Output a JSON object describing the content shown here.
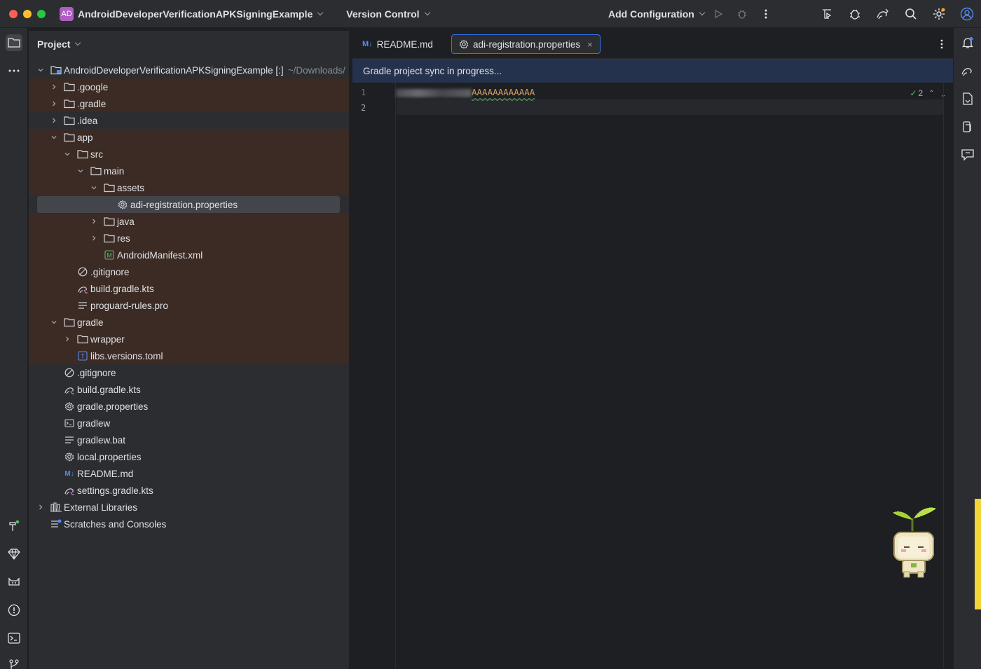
{
  "titlebar": {
    "project_badge": "AD",
    "project_name": "AndroidDeveloperVerificationAPKSigningExample",
    "vcs_label": "Version Control",
    "add_configuration": "Add Configuration"
  },
  "project_panel": {
    "title": "Project",
    "tree": [
      {
        "label": "AndroidDeveloperVerificationAPKSigningExample [:]",
        "hint": "~/Downloads/",
        "depth": 0,
        "arrow": "down",
        "icon": "module-folder-icon"
      },
      {
        "label": ".google",
        "depth": 1,
        "arrow": "right",
        "icon": "folder-icon"
      },
      {
        "label": ".gradle",
        "depth": 1,
        "arrow": "right",
        "icon": "folder-icon"
      },
      {
        "label": ".idea",
        "depth": 1,
        "arrow": "right",
        "icon": "folder-icon"
      },
      {
        "label": "app",
        "depth": 1,
        "arrow": "down",
        "icon": "folder-icon"
      },
      {
        "label": "src",
        "depth": 2,
        "arrow": "down",
        "icon": "folder-icon"
      },
      {
        "label": "main",
        "depth": 3,
        "arrow": "down",
        "icon": "folder-icon"
      },
      {
        "label": "assets",
        "depth": 4,
        "arrow": "down",
        "icon": "folder-icon"
      },
      {
        "label": "adi-registration.properties",
        "depth": 5,
        "arrow": "none",
        "icon": "properties-icon"
      },
      {
        "label": "java",
        "depth": 4,
        "arrow": "right",
        "icon": "folder-icon"
      },
      {
        "label": "res",
        "depth": 4,
        "arrow": "right",
        "icon": "folder-icon"
      },
      {
        "label": "AndroidManifest.xml",
        "depth": 4,
        "arrow": "none",
        "icon": "manifest-icon"
      },
      {
        "label": ".gitignore",
        "depth": 2,
        "arrow": "none",
        "icon": "gitignore-icon"
      },
      {
        "label": "build.gradle.kts",
        "depth": 2,
        "arrow": "none",
        "icon": "gradle-icon"
      },
      {
        "label": "proguard-rules.pro",
        "depth": 2,
        "arrow": "none",
        "icon": "text-file-icon"
      },
      {
        "label": "gradle",
        "depth": 1,
        "arrow": "down",
        "icon": "folder-icon"
      },
      {
        "label": "wrapper",
        "depth": 2,
        "arrow": "right",
        "icon": "folder-icon"
      },
      {
        "label": "libs.versions.toml",
        "depth": 2,
        "arrow": "none",
        "icon": "toml-icon"
      },
      {
        "label": ".gitignore",
        "depth": 1,
        "arrow": "none",
        "icon": "gitignore-icon"
      },
      {
        "label": "build.gradle.kts",
        "depth": 1,
        "arrow": "none",
        "icon": "gradle-icon"
      },
      {
        "label": "gradle.properties",
        "depth": 1,
        "arrow": "none",
        "icon": "properties-icon"
      },
      {
        "label": "gradlew",
        "depth": 1,
        "arrow": "none",
        "icon": "shell-icon"
      },
      {
        "label": "gradlew.bat",
        "depth": 1,
        "arrow": "none",
        "icon": "text-file-icon"
      },
      {
        "label": "local.properties",
        "depth": 1,
        "arrow": "none",
        "icon": "properties-icon"
      },
      {
        "label": "README.md",
        "depth": 1,
        "arrow": "none",
        "icon": "markdown-icon"
      },
      {
        "label": "settings.gradle.kts",
        "depth": 1,
        "arrow": "none",
        "icon": "gradle-icon"
      },
      {
        "label": "External Libraries",
        "depth": 0,
        "arrow": "right",
        "icon": "libraries-icon"
      },
      {
        "label": "Scratches and Consoles",
        "depth": 0,
        "arrow": "none",
        "icon": "scratches-icon"
      }
    ],
    "selected_index": 8
  },
  "editor": {
    "tabs": [
      {
        "label": "README.md",
        "icon": "markdown-icon",
        "active": false
      },
      {
        "label": "adi-registration.properties",
        "icon": "properties-icon",
        "active": true
      }
    ],
    "banner": "Gradle project sync in progress...",
    "line_numbers": [
      "1",
      "2"
    ],
    "line1_visible_text": "AAAAAAAAAAAA",
    "inspection_count": "2"
  },
  "colors": {
    "accent": "#3574f0",
    "panel_bg": "#2b2d30",
    "editor_bg": "#1e1f22",
    "highlight_row": "#3b2b24",
    "banner_bg": "#25324d"
  }
}
